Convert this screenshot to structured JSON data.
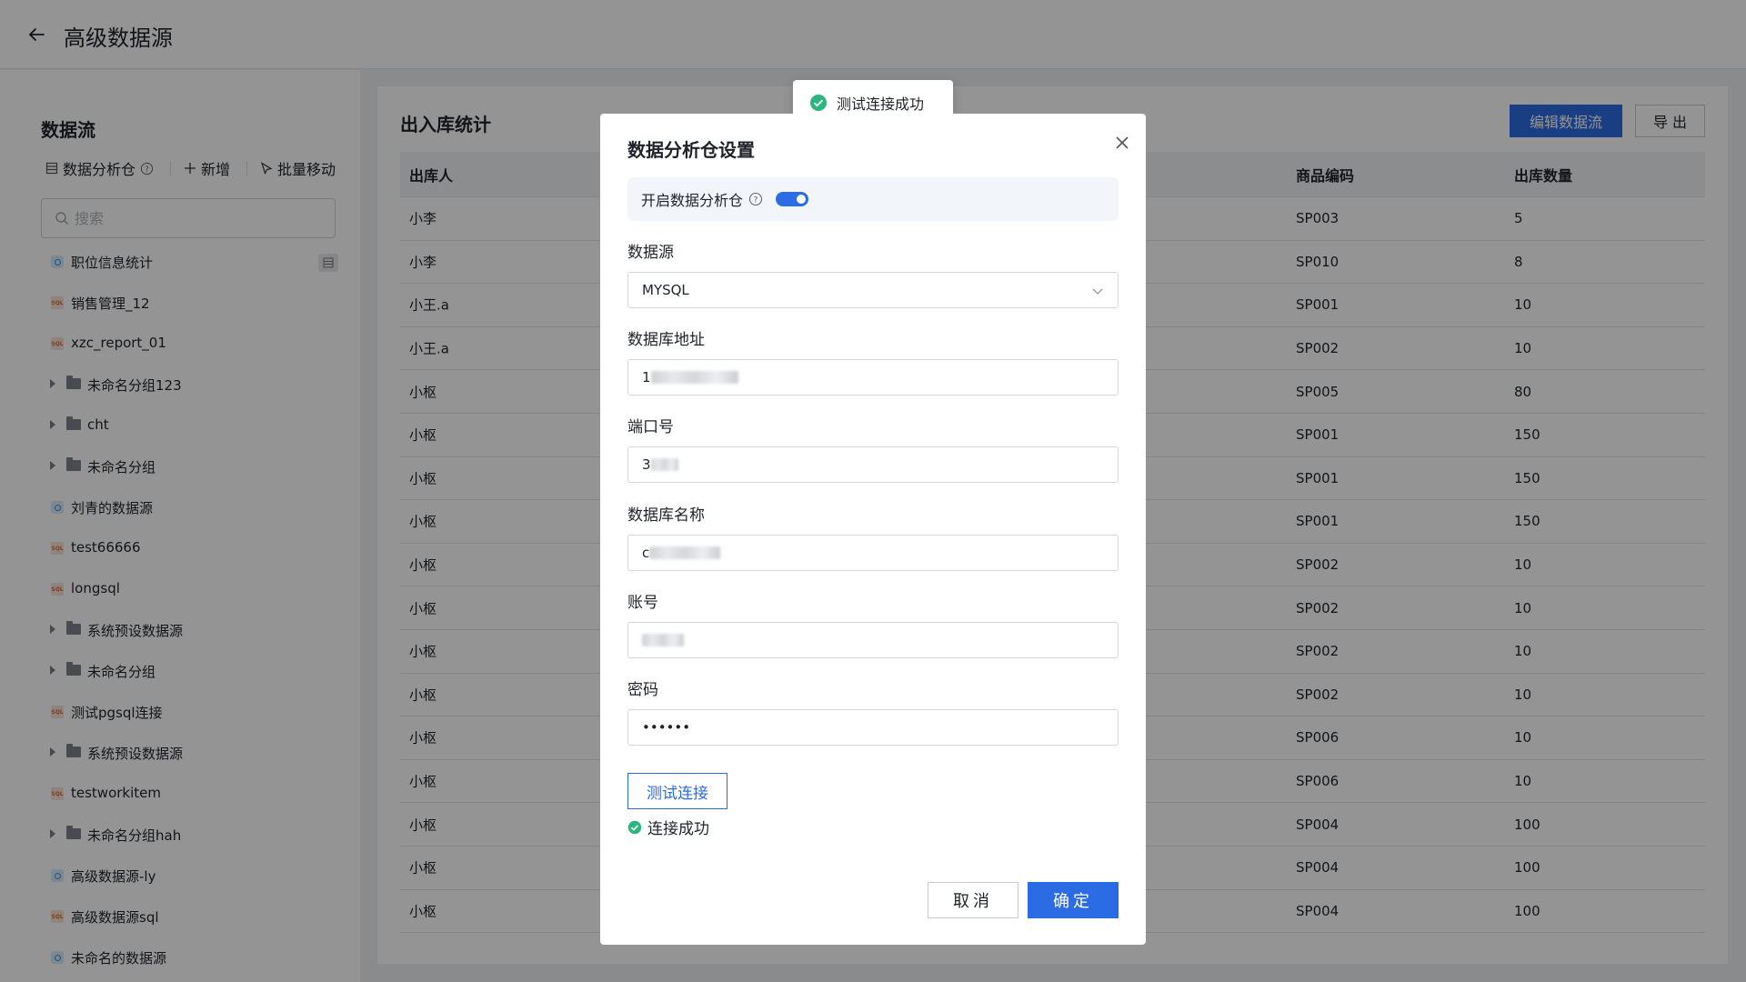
{
  "header": {
    "title": "高级数据源"
  },
  "sidebar": {
    "title": "数据流",
    "tools": {
      "warehouse": "数据分析仓",
      "add": "新增",
      "move": "批量移动"
    },
    "search_placeholder": "搜索",
    "items": [
      {
        "type": "ds",
        "label": "职位信息统计",
        "badge": true
      },
      {
        "type": "sql",
        "label": "销售管理_12"
      },
      {
        "type": "sql",
        "label": "xzc_report_01"
      },
      {
        "type": "folder",
        "label": "未命名分组123"
      },
      {
        "type": "folder",
        "label": "cht"
      },
      {
        "type": "folder",
        "label": "未命名分组"
      },
      {
        "type": "ds",
        "label": "刘青的数据源"
      },
      {
        "type": "sql",
        "label": "test66666"
      },
      {
        "type": "sql",
        "label": "longsql"
      },
      {
        "type": "folder",
        "label": "系统预设数据源"
      },
      {
        "type": "folder",
        "label": "未命名分组"
      },
      {
        "type": "sql",
        "label": "测试pgsql连接"
      },
      {
        "type": "folder",
        "label": "系统预设数据源"
      },
      {
        "type": "sql",
        "label": "testworkitem"
      },
      {
        "type": "folder",
        "label": "未命名分组hah"
      },
      {
        "type": "ds",
        "label": "高级数据源-ly"
      },
      {
        "type": "sql",
        "label": "高级数据源sql"
      },
      {
        "type": "ds",
        "label": "未命名的数据源"
      }
    ]
  },
  "main": {
    "title": "出入库统计",
    "edit_button": "编辑数据流",
    "export_button": "导 出",
    "columns": [
      "出库人",
      "商品编码",
      "出库数量"
    ],
    "rows": [
      [
        "小李",
        "SP003",
        "5"
      ],
      [
        "小李",
        "SP010",
        "8"
      ],
      [
        "小王.a",
        "SP001",
        "10"
      ],
      [
        "小王.a",
        "SP002",
        "10"
      ],
      [
        "小枢",
        "SP005",
        "80"
      ],
      [
        "小枢",
        "SP001",
        "150"
      ],
      [
        "小枢",
        "SP001",
        "150"
      ],
      [
        "小枢",
        "SP001",
        "150"
      ],
      [
        "小枢",
        "SP002",
        "10"
      ],
      [
        "小枢",
        "SP002",
        "10"
      ],
      [
        "小枢",
        "SP002",
        "10"
      ],
      [
        "小枢",
        "SP002",
        "10"
      ],
      [
        "小枢",
        "SP006",
        "10"
      ],
      [
        "小枢",
        "SP006",
        "10"
      ],
      [
        "小枢",
        "SP004",
        "100"
      ],
      [
        "小枢",
        "SP004",
        "100"
      ],
      [
        "小枢",
        "SP004",
        "100"
      ]
    ]
  },
  "toast": {
    "text": "测试连接成功"
  },
  "modal": {
    "title": "数据分析仓设置",
    "switch_label": "开启数据分析仓",
    "switch_on": true,
    "fields": {
      "source_label": "数据源",
      "source_value": "MYSQL",
      "host_label": "数据库地址",
      "host_value": "1",
      "port_label": "端口号",
      "port_value": "3",
      "dbname_label": "数据库名称",
      "dbname_value": "c",
      "account_label": "账号",
      "password_label": "密码",
      "password_value": "••••••"
    },
    "test_button": "测试连接",
    "test_result": "连接成功",
    "cancel_button": "取消",
    "ok_button": "确定"
  }
}
